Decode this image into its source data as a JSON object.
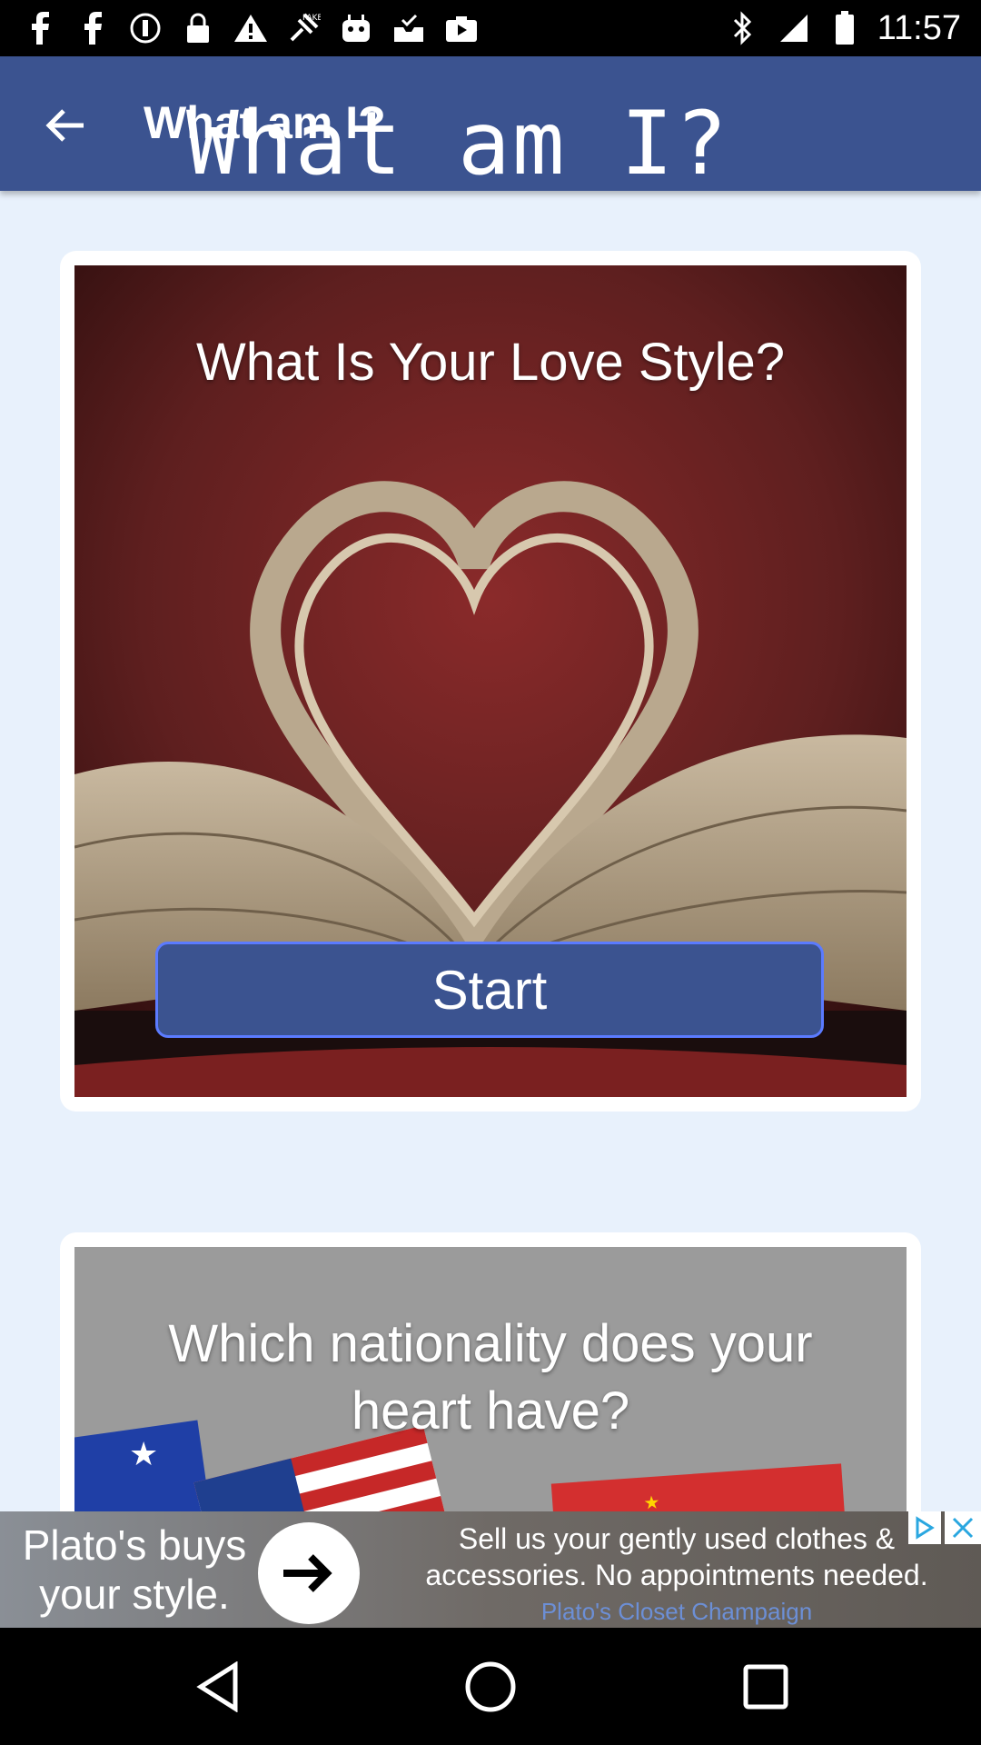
{
  "status_bar": {
    "time": "11:57",
    "left_icons": [
      "facebook-icon",
      "facebook-icon",
      "shield-icon",
      "lock-icon",
      "warning-icon",
      "fake-gps-icon",
      "robot-icon",
      "inbox-check-icon",
      "play-store-icon"
    ],
    "right_icons": [
      "bluetooth-icon",
      "signal-icon",
      "battery-icon"
    ]
  },
  "app_bar": {
    "title": "What am I?",
    "title_overlay": "What am I?"
  },
  "cards": [
    {
      "title": "What Is Your Love Style?",
      "button_label": "Start"
    },
    {
      "title": "Which nationality does your heart have?"
    }
  ],
  "ad": {
    "headline": "Plato's buys your style.",
    "body": "Sell us your gently used clothes & accessories. No appointments needed.",
    "sponsor": "Plato's Closet Champaign"
  },
  "colors": {
    "primary": "#3b5390",
    "background": "#e8f1fc",
    "button_border": "#5b7bff"
  }
}
